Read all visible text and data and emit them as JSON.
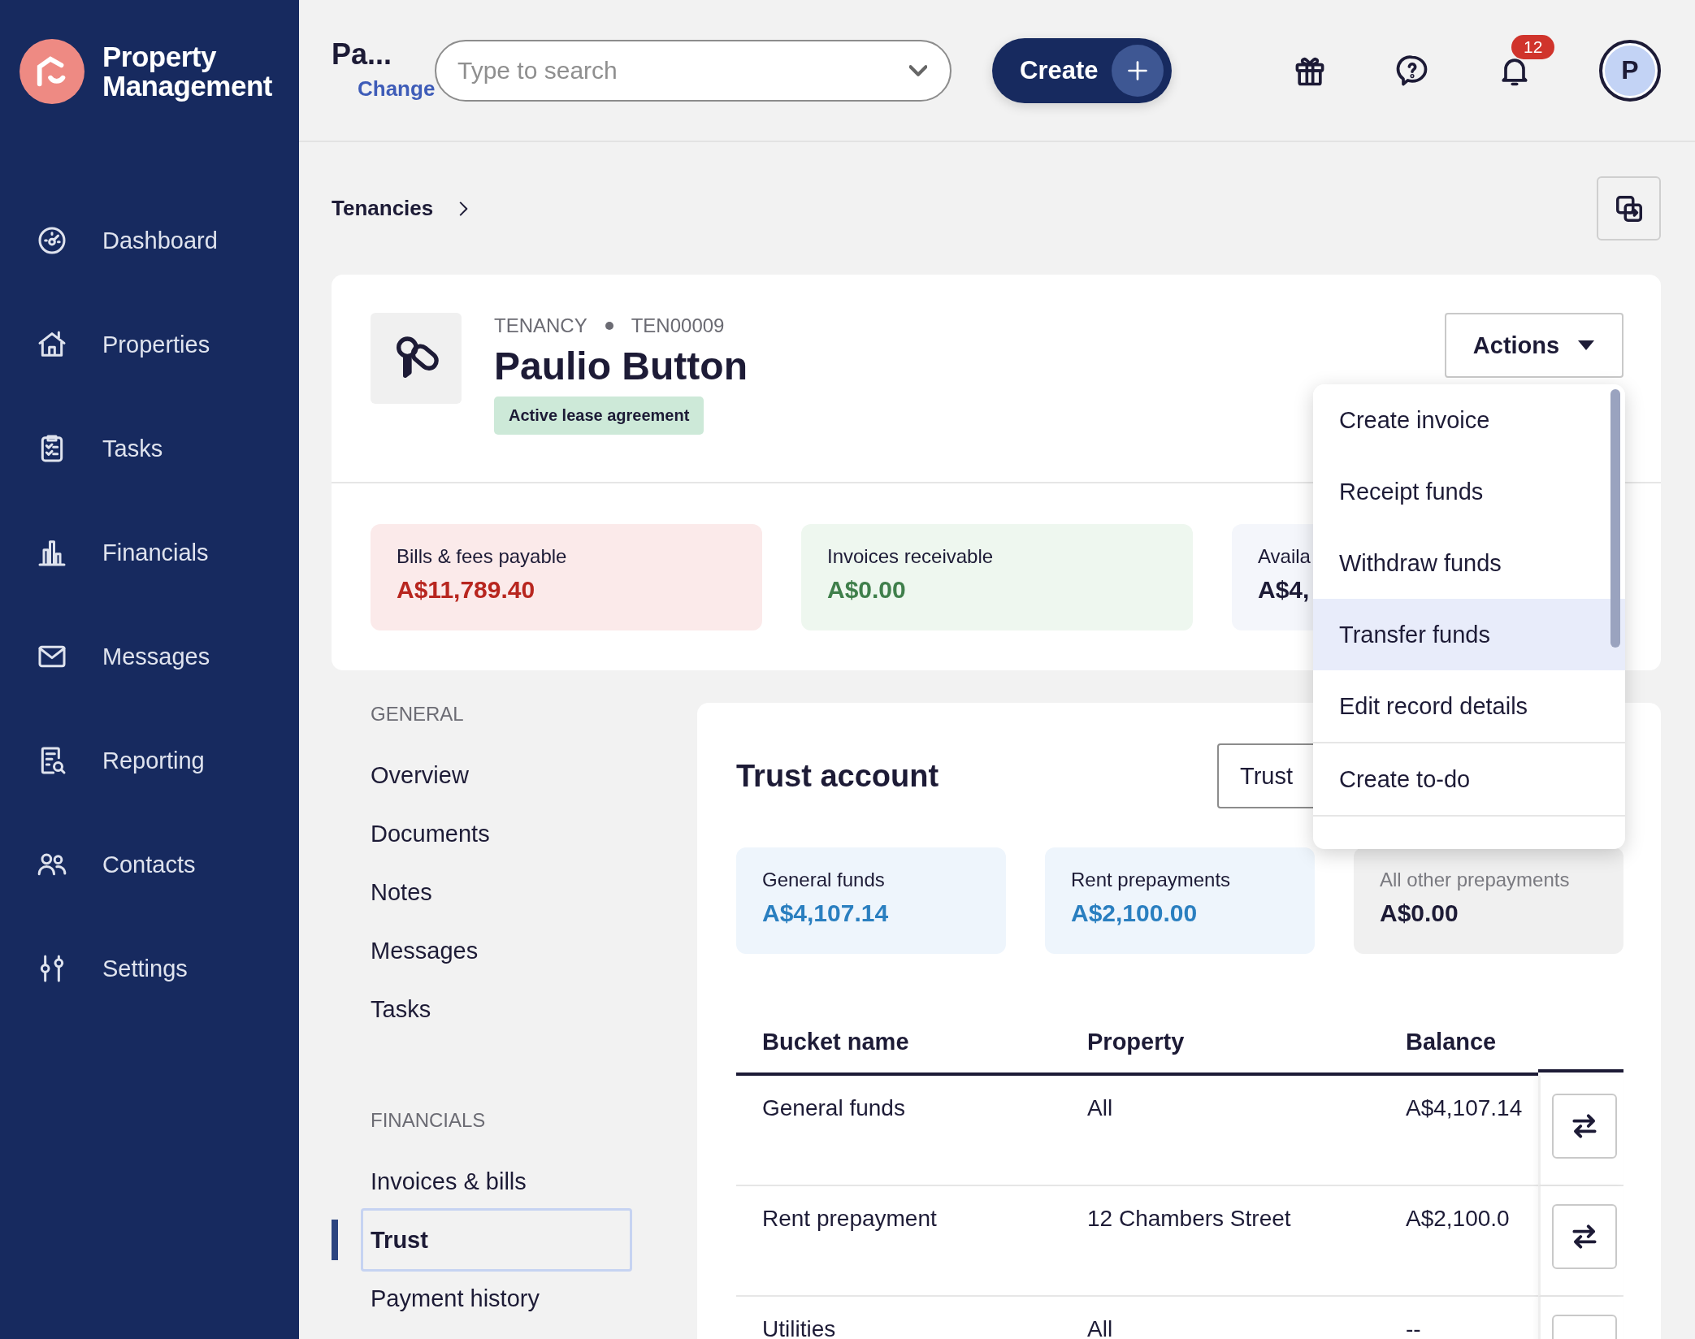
{
  "app": {
    "name": "Property Management"
  },
  "sidebar": {
    "items": [
      {
        "label": "Dashboard"
      },
      {
        "label": "Properties"
      },
      {
        "label": "Tasks"
      },
      {
        "label": "Financials"
      },
      {
        "label": "Messages"
      },
      {
        "label": "Reporting"
      },
      {
        "label": "Contacts"
      },
      {
        "label": "Settings"
      }
    ]
  },
  "topbar": {
    "context_title": "Pa...",
    "change_link": "Change",
    "search": {
      "placeholder": "Type to search"
    },
    "create_button": "Create",
    "notification_count": "12",
    "avatar_initial": "P"
  },
  "breadcrumb": [
    "Tenancies"
  ],
  "tenancy": {
    "type": "TENANCY",
    "id": "TEN00009",
    "name": "Paulio Button",
    "status": "Active lease agreement",
    "actions_button": "Actions"
  },
  "summary_cards": [
    {
      "label": "Bills & fees payable",
      "value": "A$11,789.40",
      "kind": "danger"
    },
    {
      "label": "Invoices receivable",
      "value": "A$0.00",
      "kind": "success"
    },
    {
      "label": "Availa",
      "value": "A$4,",
      "kind": "neutral"
    }
  ],
  "actions_menu": {
    "items": [
      {
        "label": "Create invoice",
        "highlighted": false
      },
      {
        "label": "Receipt funds",
        "highlighted": false
      },
      {
        "label": "Withdraw funds",
        "highlighted": false
      },
      {
        "label": "Transfer funds",
        "highlighted": true
      },
      {
        "label": "Edit record details",
        "highlighted": false
      },
      {
        "label": "Create to-do",
        "highlighted": false
      }
    ]
  },
  "section_nav": {
    "groups": [
      {
        "title": "GENERAL",
        "items": [
          {
            "label": "Overview",
            "selected": false
          },
          {
            "label": "Documents",
            "selected": false
          },
          {
            "label": "Notes",
            "selected": false
          },
          {
            "label": "Messages",
            "selected": false
          },
          {
            "label": "Tasks",
            "selected": false
          }
        ]
      },
      {
        "title": "FINANCIALS",
        "items": [
          {
            "label": "Invoices & bills",
            "selected": false
          },
          {
            "label": "Trust",
            "selected": true
          },
          {
            "label": "Payment history",
            "selected": false
          }
        ]
      }
    ]
  },
  "trust": {
    "title": "Trust account",
    "account_select": "Trust",
    "funds": [
      {
        "label": "General funds",
        "value": "A$4,107.14",
        "kind": "primary"
      },
      {
        "label": "Rent prepayments",
        "value": "A$2,100.00",
        "kind": "primary"
      },
      {
        "label": "All other prepayments",
        "value": "A$0.00",
        "kind": "muted"
      }
    ],
    "table": {
      "columns": [
        "Bucket name",
        "Property",
        "Balance"
      ],
      "rows": [
        {
          "cells": [
            "General funds",
            "All",
            "A$4,107.14"
          ]
        },
        {
          "cells": [
            "Rent prepayment",
            "12 Chambers Street",
            "A$2,100.0"
          ]
        },
        {
          "cells": [
            "Utilities",
            "All",
            "--"
          ]
        }
      ]
    }
  }
}
